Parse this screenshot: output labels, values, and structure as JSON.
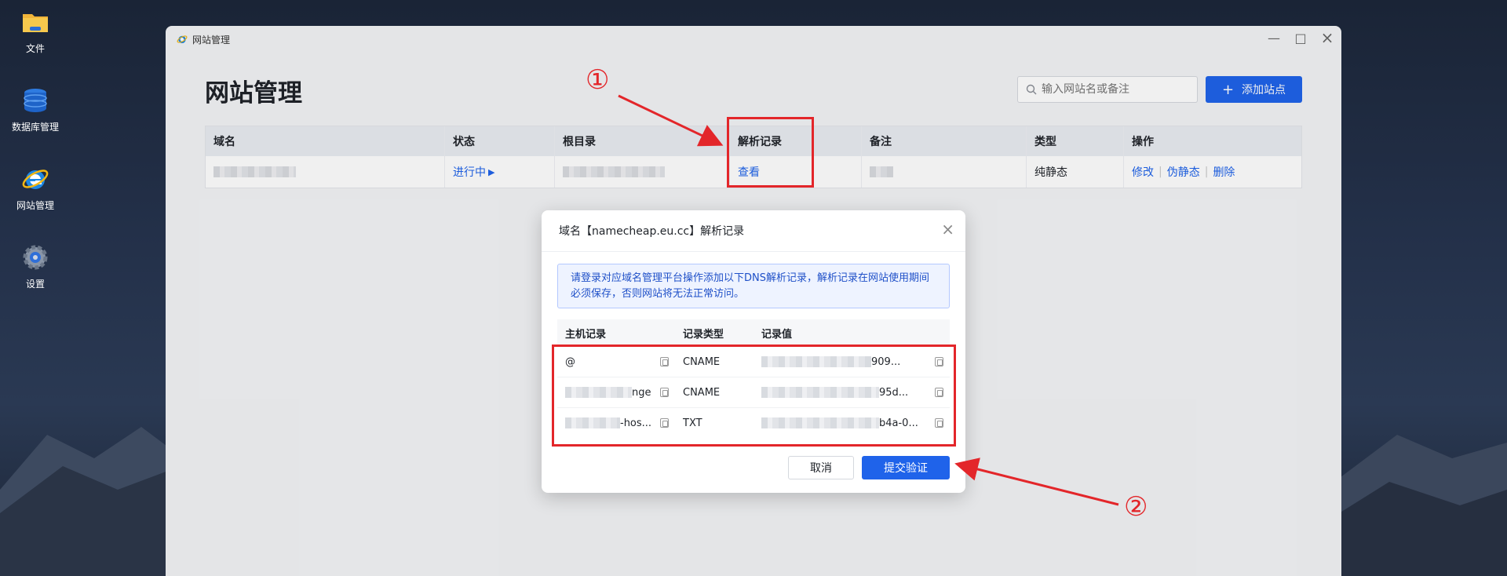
{
  "desktop": {
    "icons": [
      {
        "label": "文件",
        "icon": "folder-icon"
      },
      {
        "label": "数据库管理",
        "icon": "database-icon"
      },
      {
        "label": "网站管理",
        "icon": "ie-icon"
      },
      {
        "label": "设置",
        "icon": "gear-icon"
      }
    ]
  },
  "window": {
    "title": "网站管理",
    "page_title": "网站管理",
    "search_placeholder": "输入网站名或备注",
    "add_button": "添加站点",
    "columns": [
      "域名",
      "状态",
      "根目录",
      "解析记录",
      "备注",
      "类型",
      "操作"
    ],
    "row": {
      "status": "进行中",
      "dns_link": "查看",
      "type": "纯静态",
      "actions": [
        "修改",
        "伪静态",
        "删除"
      ]
    }
  },
  "dialog": {
    "title": "域名【namecheap.eu.cc】解析记录",
    "alert": "请登录对应域名管理平台操作添加以下DNS解析记录，解析记录在网站使用期间必须保存，否则网站将无法正常访问。",
    "columns": [
      "主机记录",
      "记录类型",
      "记录值"
    ],
    "rows": [
      {
        "host": "@",
        "type": "CNAME",
        "value": "909..."
      },
      {
        "host": "nge",
        "type": "CNAME",
        "value": "95d..."
      },
      {
        "host": "-hos...",
        "type": "TXT",
        "value": "b4a-0..."
      }
    ],
    "cancel": "取消",
    "submit": "提交验证"
  },
  "annotations": {
    "marker1": "①",
    "marker2": "②",
    "color": "#e3262a"
  }
}
